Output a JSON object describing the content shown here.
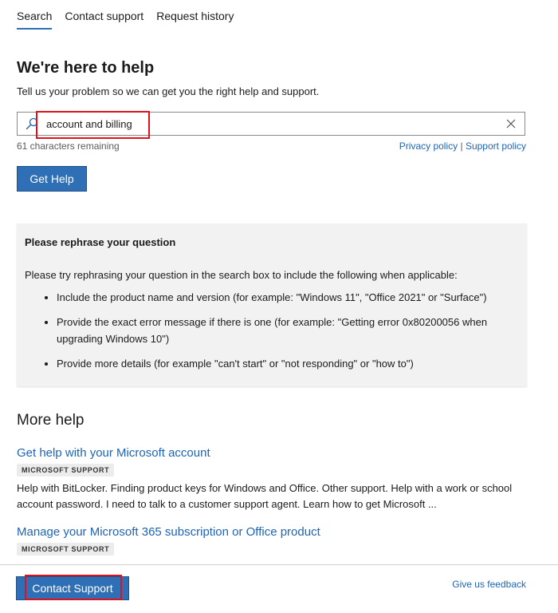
{
  "tabs": [
    {
      "label": "Search"
    },
    {
      "label": "Contact support"
    },
    {
      "label": "Request history"
    }
  ],
  "header": {
    "title": "We're here to help",
    "subtitle": "Tell us your problem so we can get you the right help and support."
  },
  "search": {
    "value": "account and billing",
    "chars_remaining": "61 characters remaining",
    "privacy_policy": "Privacy policy",
    "separator": "|",
    "support_policy": "Support policy",
    "button_label": "Get Help"
  },
  "rephrase": {
    "title": "Please rephrase your question",
    "lead": "Please try rephrasing your question in the search box to include the following when applicable:",
    "bullets": [
      "Include the product name and version (for example: \"Windows 11\", \"Office 2021\" or \"Surface\")",
      "Provide the exact error message if there is one (for example: \"Getting error 0x80200056 when upgrading Windows 10\")",
      "Provide more details (for example \"can't start\" or \"not responding\" or \"how to\")"
    ]
  },
  "more_help": {
    "title": "More help",
    "items": [
      {
        "title": "Get help with your Microsoft account",
        "badge": "MICROSOFT SUPPORT",
        "desc": "Help with BitLocker. Finding product keys for Windows and Office. Other support. Help with a work or school account password. I need to talk to a customer support agent. Learn how to get Microsoft ..."
      },
      {
        "title": "Manage your Microsoft 365 subscription or Office product",
        "badge": "MICROSOFT SUPPORT",
        "desc": ""
      }
    ]
  },
  "footer": {
    "contact_label": "Contact Support",
    "feedback_label": "Give us feedback"
  },
  "colors": {
    "accent": "#2f6fb6",
    "link": "#1e64b4",
    "highlight": "#e0111b",
    "panel": "#f2f2f2"
  }
}
